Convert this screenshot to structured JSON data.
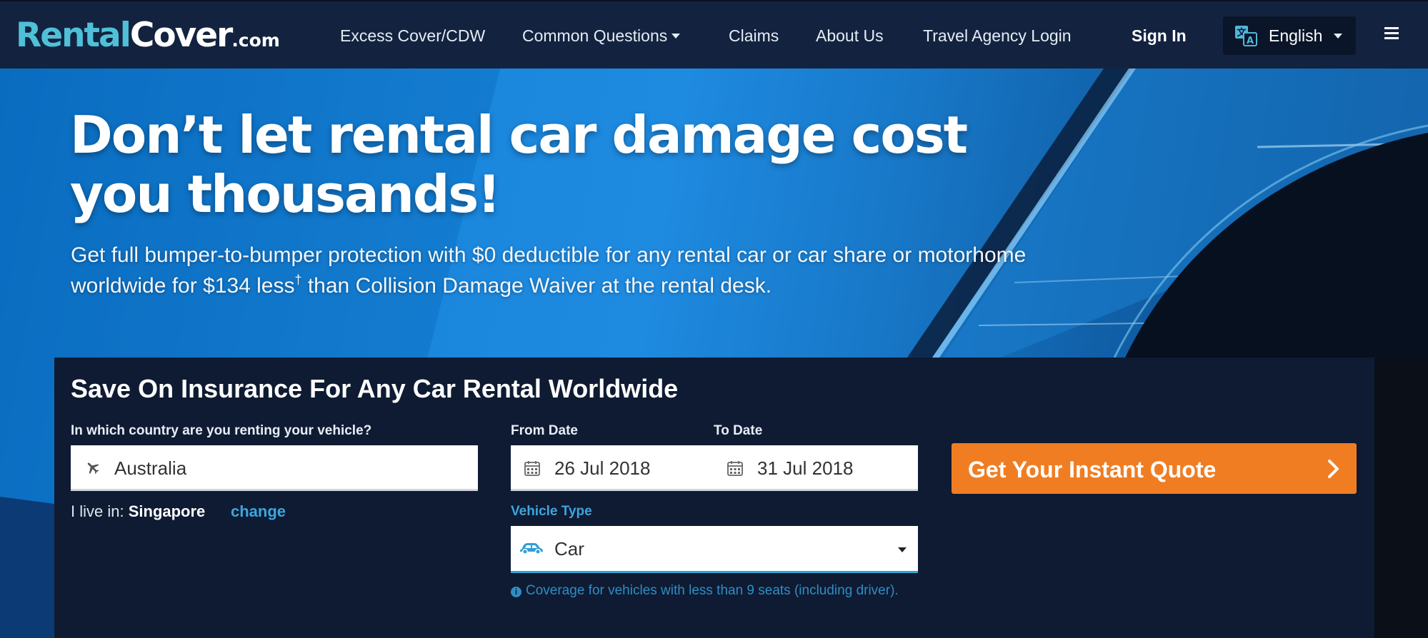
{
  "header": {
    "logo": {
      "part1": "Rental",
      "part2": "Cover",
      "part3": ".com"
    },
    "nav": [
      {
        "label": "Excess Cover/CDW"
      },
      {
        "label": "Common Questions"
      },
      {
        "label": "Claims"
      },
      {
        "label": "About Us"
      },
      {
        "label": "Travel Agency Login"
      }
    ],
    "sign_in": "Sign In",
    "language": "English"
  },
  "hero": {
    "title": "Don’t let rental car damage cost you thousands!",
    "subtitle_before": "Get full bumper-to-bumper protection with $0 deductible for any rental car or car share or motorhome worldwide for $134 less",
    "subtitle_mark": "†",
    "subtitle_after": " than Collision Damage Waiver at the rental desk."
  },
  "form": {
    "title": "Save On Insurance For Any Car Rental Worldwide",
    "country_label": "In which country are you renting your vehicle?",
    "country_value": "Australia",
    "live_in_label": "I live in:",
    "live_in_value": "Singapore",
    "change_link": "change",
    "from_label": "From Date",
    "from_value": "26 Jul 2018",
    "to_label": "To Date",
    "to_value": "31 Jul 2018",
    "vehicle_label": "Vehicle Type",
    "vehicle_value": "Car",
    "vehicle_note": "Coverage for vehicles with less than 9 seats (including driver).",
    "quote_button": "Get Your Instant Quote"
  },
  "colors": {
    "header_bg": "#13233f",
    "logo_accent": "#4fc0d8",
    "panel_bg": "#0e1b32",
    "cta": "#f07d22",
    "link": "#3ea5dd"
  },
  "icons": [
    "translate-icon",
    "hamburger-icon",
    "plane-icon",
    "calendar-icon",
    "car-icon",
    "info-icon",
    "chevron-right-icon"
  ]
}
